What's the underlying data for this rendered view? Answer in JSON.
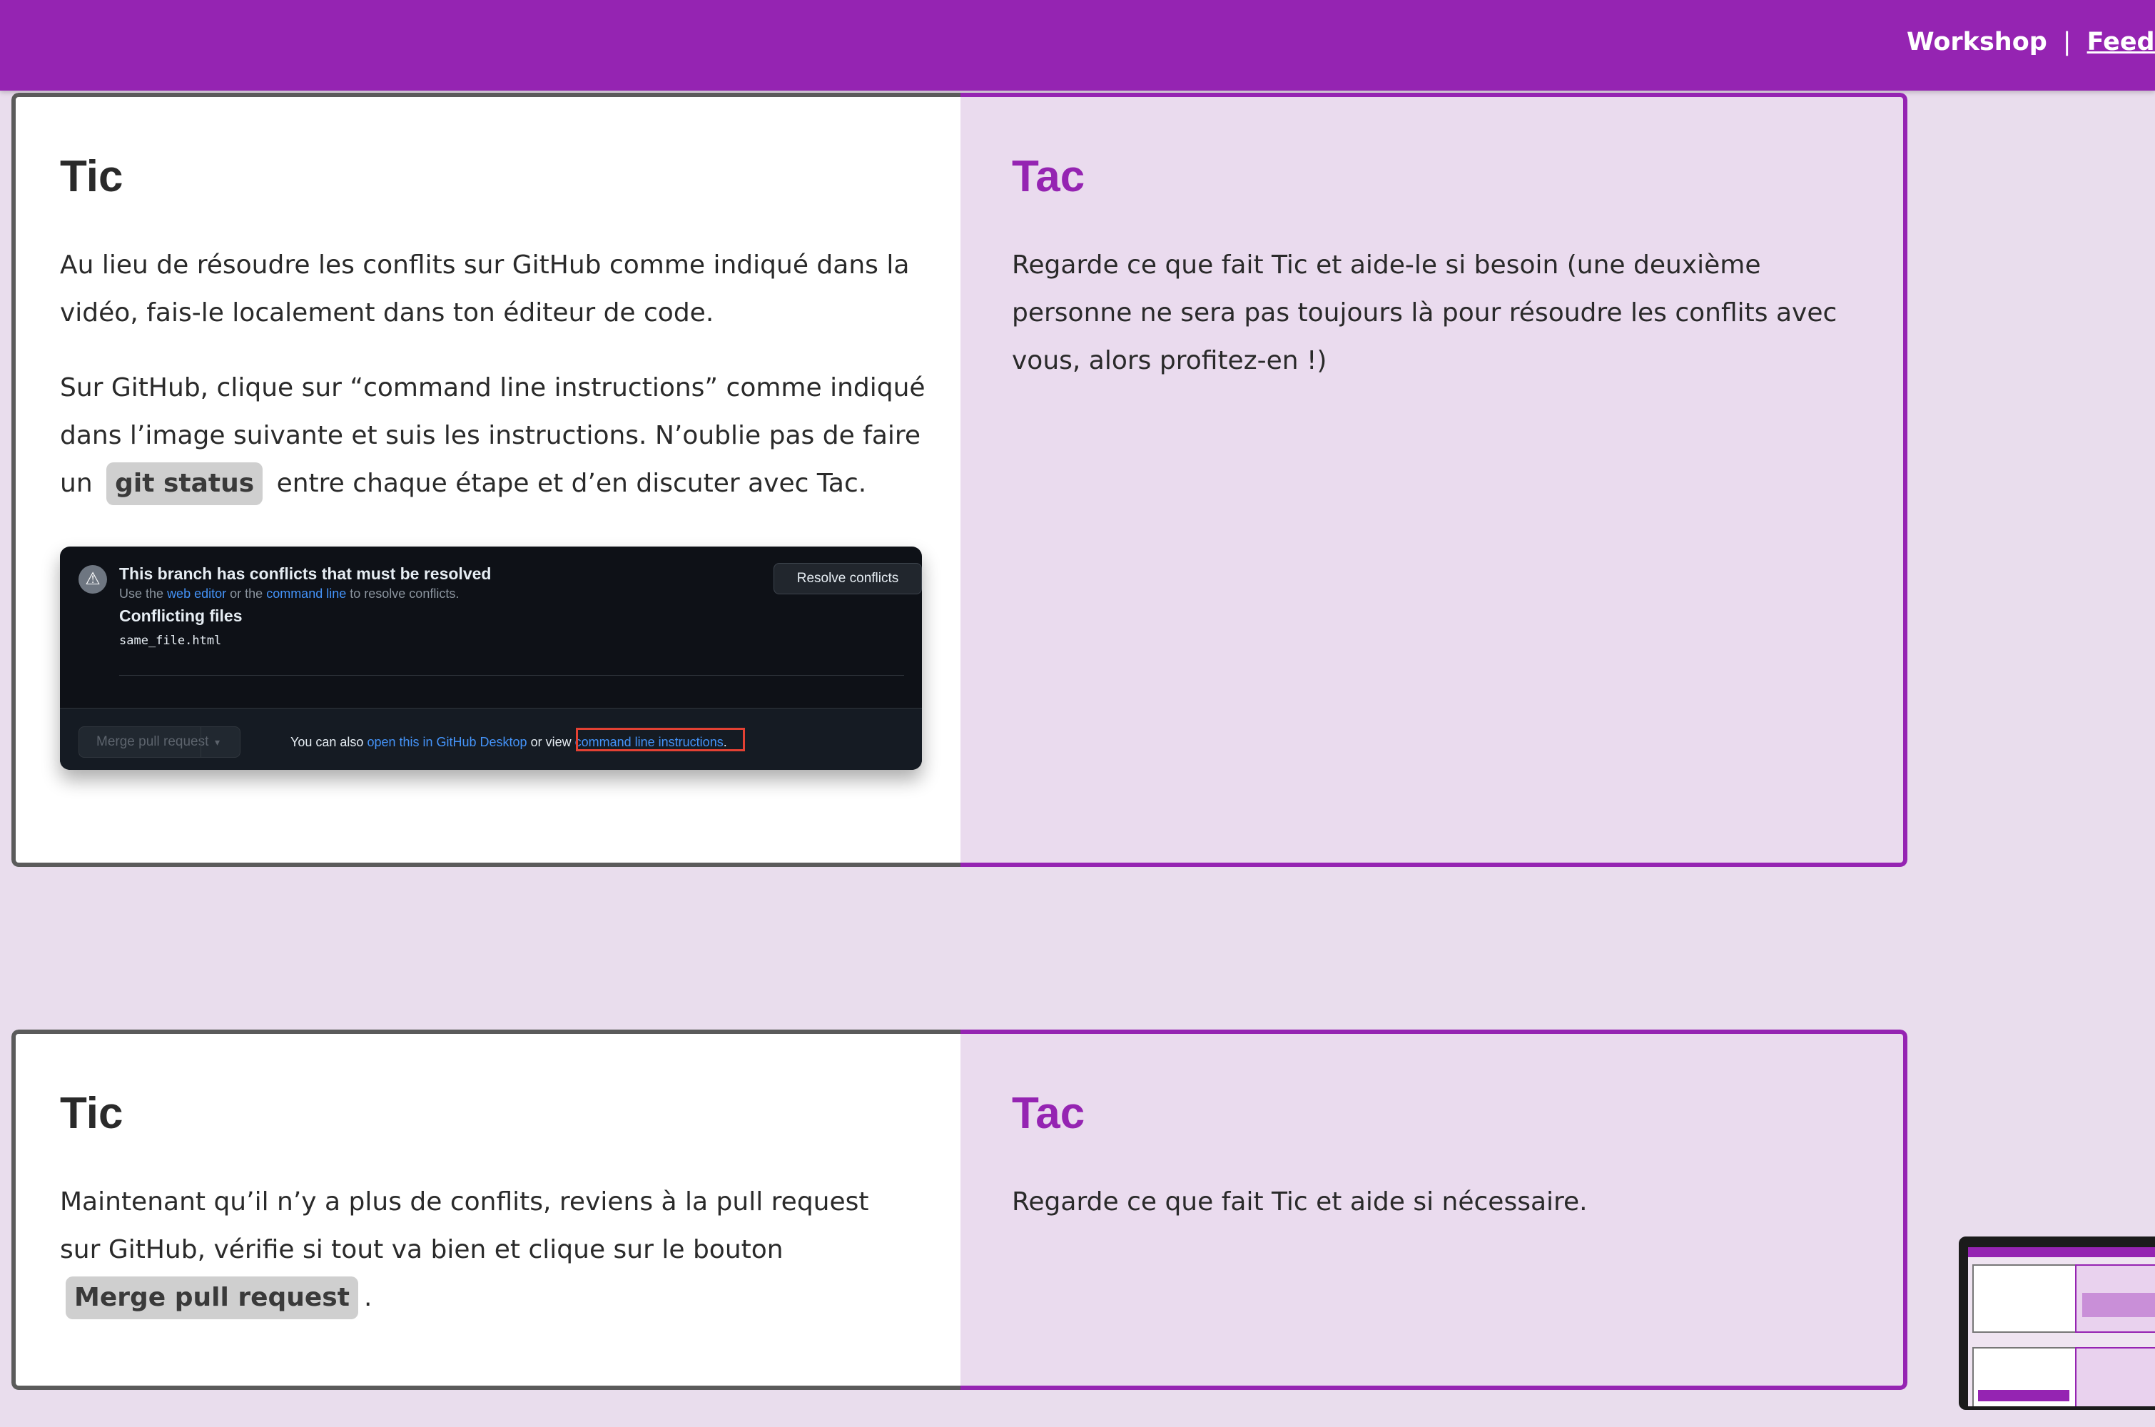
{
  "nav": {
    "workshop": "Workshop",
    "separator": "|",
    "feedback": "Feedba"
  },
  "section1": {
    "tic": {
      "title": "Tic",
      "para1": "Au lieu de résoudre les conflits sur GitHub comme indiqué dans la vidéo, fais-le localement dans ton éditeur de code.",
      "para2_before": "Sur GitHub, clique sur “command line instructions” comme indiqué dans l’image suivante et suis les instructions. N’oublie pas de faire un",
      "code": "git status",
      "para2_after": "entre chaque étape et d’en discuter avec Tac."
    },
    "tac": {
      "title": "Tac",
      "para1": "Regarde ce que fait Tic et aide-le si besoin (une deuxième personne ne sera pas toujours là pour résoudre les conflits avec vous, alors profitez-en !)"
    },
    "github": {
      "warning_icon": "warning-triangle-icon",
      "heading": "This branch has conflicts that must be resolved",
      "use_the": "Use the",
      "web_editor": "web editor",
      "or_the": "or the",
      "command_line": "command line",
      "to_resolve": "to resolve conflicts.",
      "conflicting_files": "Conflicting files",
      "file": "same_file.html",
      "resolve_button": "Resolve conflicts",
      "merge_button": "Merge pull request",
      "caret_icon": "chevron-down-icon",
      "also": "You can also",
      "desktop_link": "open this in GitHub Desktop",
      "or_view": "or view",
      "cli_link": "command line instructions",
      "period": "."
    }
  },
  "section2": {
    "tic": {
      "title": "Tic",
      "para1_before": "Maintenant qu’il n’y a plus de conflits, reviens à la pull request sur GitHub, vérifie si tout va bien et clique sur le bouton",
      "code": "Merge pull request",
      "para1_after": "."
    },
    "tac": {
      "title": "Tac",
      "para1": "Regarde ce que fait Tic et aide si nécessaire."
    }
  },
  "colors": {
    "brand": "#9524b2",
    "background": "#e9dded",
    "code_chip": "#cfcfcf"
  }
}
